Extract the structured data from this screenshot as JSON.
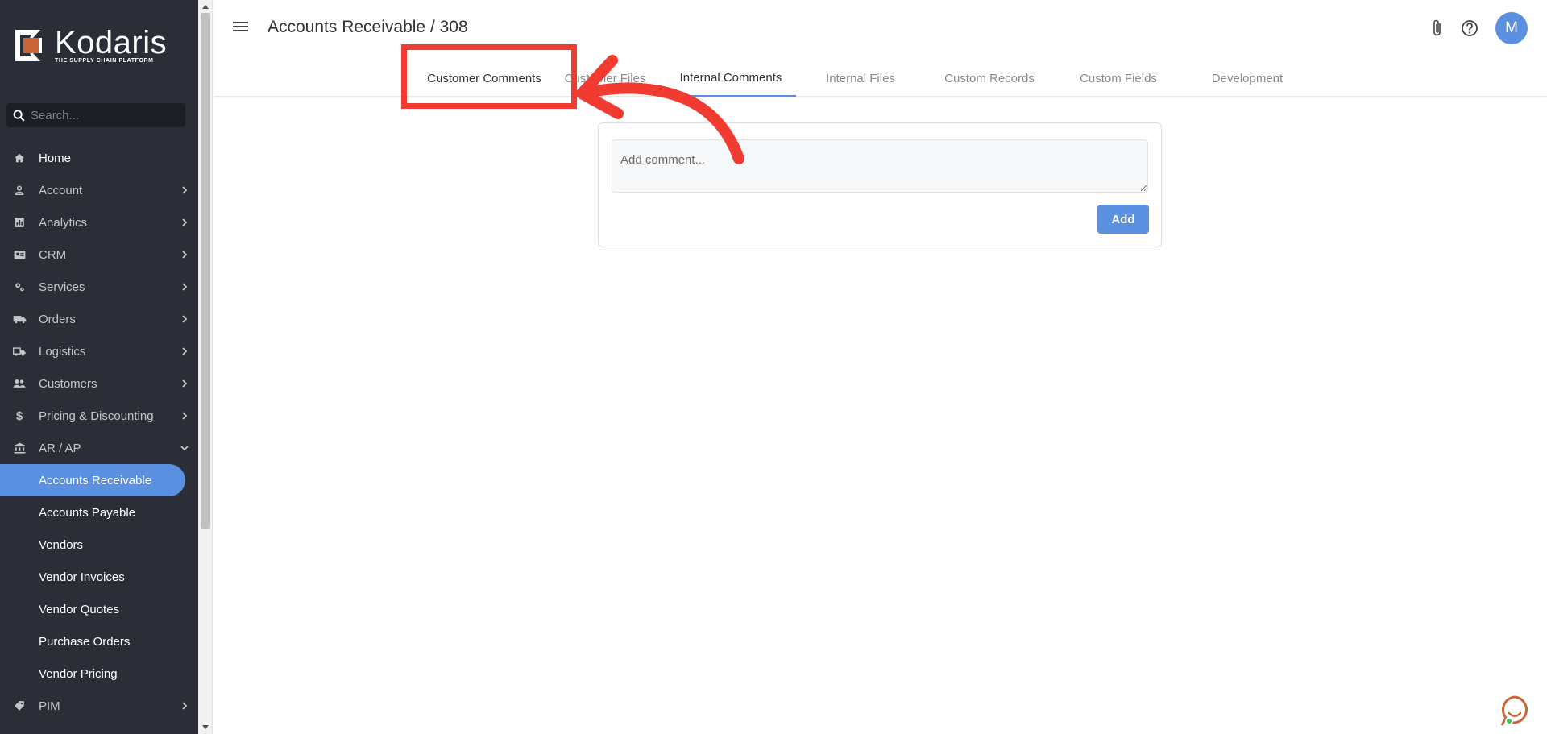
{
  "sidebar": {
    "logo": {
      "name": "Kodaris",
      "tagline": "THE SUPPLY CHAIN PLATFORM"
    },
    "search": {
      "placeholder": "Search..."
    },
    "items": [
      {
        "label": "Home",
        "icon": "home-icon"
      },
      {
        "label": "Account",
        "icon": "person-icon"
      },
      {
        "label": "Analytics",
        "icon": "analytics-icon"
      },
      {
        "label": "CRM",
        "icon": "contact-card-icon"
      },
      {
        "label": "Services",
        "icon": "gears-icon"
      },
      {
        "label": "Orders",
        "icon": "truck-icon"
      },
      {
        "label": "Logistics",
        "icon": "shipping-icon"
      },
      {
        "label": "Customers",
        "icon": "people-icon"
      },
      {
        "label": "Pricing & Discounting",
        "icon": "dollar-icon"
      },
      {
        "label": "AR / AP",
        "icon": "bank-icon"
      }
    ],
    "subitems": [
      {
        "label": "Accounts Receivable"
      },
      {
        "label": "Accounts Payable"
      },
      {
        "label": "Vendors"
      },
      {
        "label": "Vendor Invoices"
      },
      {
        "label": "Vendor Quotes"
      },
      {
        "label": "Purchase Orders"
      },
      {
        "label": "Vendor Pricing"
      }
    ],
    "pim": {
      "label": "PIM",
      "icon": "tag-icon"
    }
  },
  "header": {
    "title": "Accounts Receivable / 308",
    "avatar_initial": "M"
  },
  "tabs": [
    {
      "label": "Customer Comments"
    },
    {
      "label": "Customer Files"
    },
    {
      "label": "Internal Comments"
    },
    {
      "label": "Internal Files"
    },
    {
      "label": "Custom Records"
    },
    {
      "label": "Custom Fields"
    },
    {
      "label": "Development"
    }
  ],
  "comment": {
    "placeholder": "Add comment...",
    "add_label": "Add"
  },
  "colors": {
    "sidebar_bg": "#2b2e37",
    "accent": "#5b8fe0",
    "annotation": "#f23b30"
  }
}
